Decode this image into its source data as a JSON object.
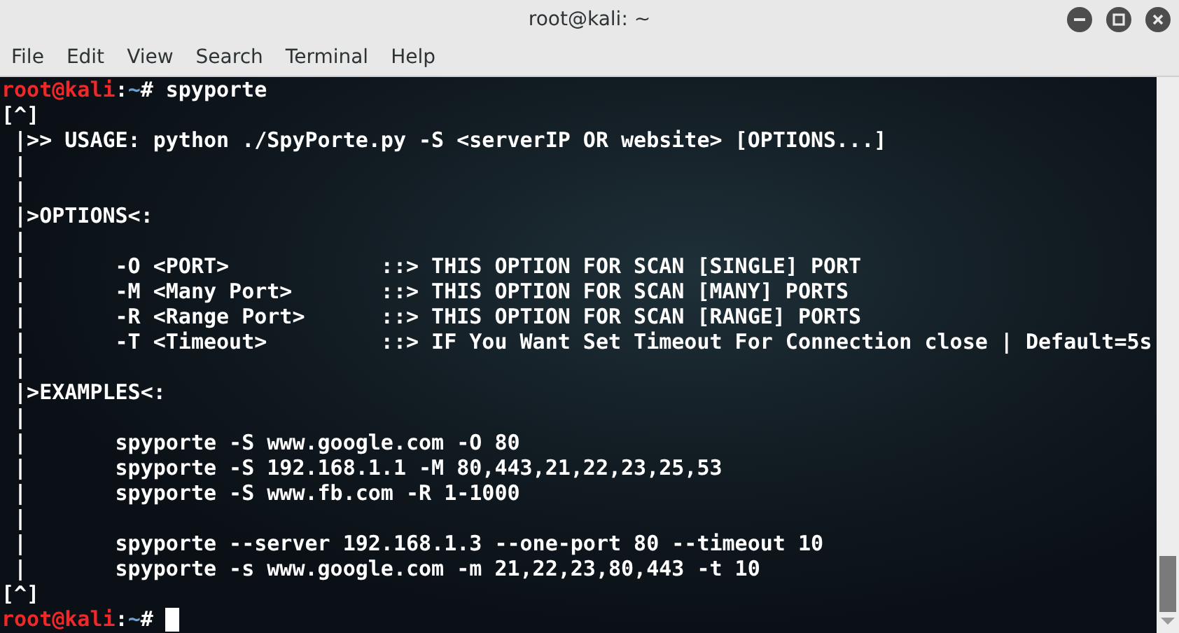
{
  "window": {
    "title": "root@kali: ~"
  },
  "menu": [
    "File",
    "Edit",
    "View",
    "Search",
    "Terminal",
    "Help"
  ],
  "terminal": {
    "lines": [
      {
        "kind": "prompt",
        "user_host": "root@kali",
        "separator": ":",
        "path": "~",
        "symbol": "#",
        "command": "spyporte",
        "cursor": false
      },
      {
        "kind": "output",
        "text": "[^]"
      },
      {
        "kind": "output",
        "text": " |>> USAGE: python ./SpyPorte.py -S <serverIP OR website> [OPTIONS...]"
      },
      {
        "kind": "output",
        "text": " |"
      },
      {
        "kind": "output",
        "text": " |"
      },
      {
        "kind": "output",
        "text": " |>OPTIONS<:"
      },
      {
        "kind": "output",
        "text": " |"
      },
      {
        "kind": "output",
        "text": " |       -O <PORT>            ::> THIS OPTION FOR SCAN [SINGLE] PORT"
      },
      {
        "kind": "output",
        "text": " |       -M <Many Port>       ::> THIS OPTION FOR SCAN [MANY] PORTS"
      },
      {
        "kind": "output",
        "text": " |       -R <Range Port>      ::> THIS OPTION FOR SCAN [RANGE] PORTS"
      },
      {
        "kind": "output",
        "text": " |       -T <Timeout>         ::> IF You Want Set Timeout For Connection close | Default=5s"
      },
      {
        "kind": "output",
        "text": " |"
      },
      {
        "kind": "output",
        "text": " |>EXAMPLES<:"
      },
      {
        "kind": "output",
        "text": " |"
      },
      {
        "kind": "output",
        "text": " |       spyporte -S www.google.com -O 80"
      },
      {
        "kind": "output",
        "text": " |       spyporte -S 192.168.1.1 -M 80,443,21,22,23,25,53"
      },
      {
        "kind": "output",
        "text": " |       spyporte -S www.fb.com -R 1-1000"
      },
      {
        "kind": "output",
        "text": " |"
      },
      {
        "kind": "output",
        "text": " |       spyporte --server 192.168.1.3 --one-port 80 --timeout 10"
      },
      {
        "kind": "output",
        "text": " |       spyporte -s www.google.com -m 21,22,23,80,443 -t 10"
      },
      {
        "kind": "output",
        "text": "[^]"
      },
      {
        "kind": "prompt",
        "user_host": "root@kali",
        "separator": ":",
        "path": "~",
        "symbol": "#",
        "cursor": true
      }
    ]
  }
}
